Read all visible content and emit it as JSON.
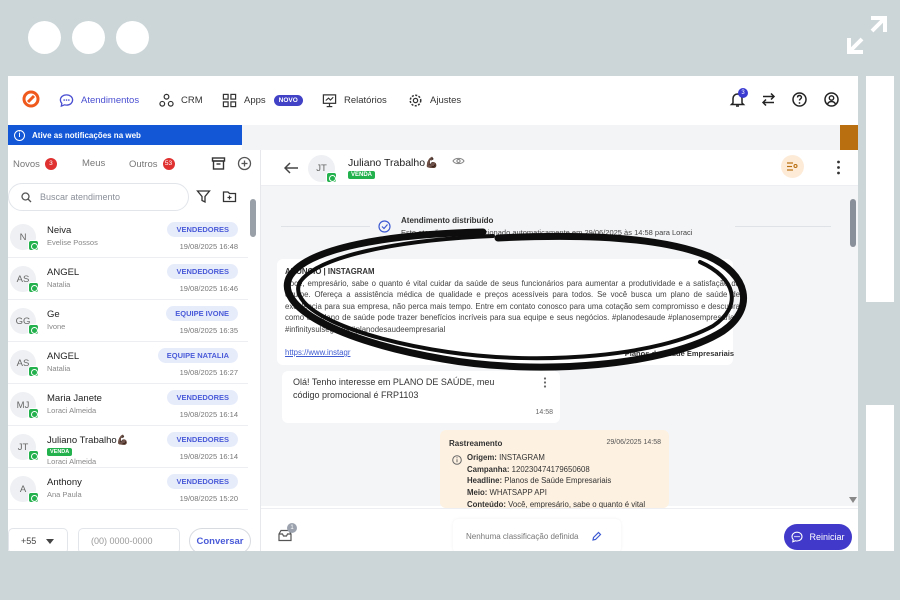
{
  "nav": {
    "items": [
      {
        "label": "Atendimentos",
        "icon": "chat-icon"
      },
      {
        "label": "CRM",
        "icon": "crm-icon"
      },
      {
        "label": "Apps",
        "icon": "apps-grid-icon",
        "badge": "NOVO"
      },
      {
        "label": "Relatórios",
        "icon": "chart-icon"
      },
      {
        "label": "Ajustes",
        "icon": "gear-icon"
      }
    ],
    "notification_count": "3"
  },
  "notif_bar": {
    "text": "Ative as notificações na web"
  },
  "tabs": [
    {
      "label": "Novos",
      "count": "3"
    },
    {
      "label": "Meus"
    },
    {
      "label": "Outros",
      "count": "53"
    }
  ],
  "search": {
    "placeholder": "Buscar atendimento"
  },
  "conversations": [
    {
      "initials": "N",
      "name": "Neiva",
      "sub": "Evelise Possos",
      "tag": "VENDEDORES",
      "time": "19/08/2025 16:48"
    },
    {
      "initials": "AS",
      "name": "ANGEL",
      "sub": "Natalia",
      "tag": "VENDEDORES",
      "time": "19/08/2025 16:46"
    },
    {
      "initials": "GG",
      "name": "Ge",
      "sub": "Ivone",
      "tag": "EQUIPE IVONE",
      "time": "19/08/2025 16:35"
    },
    {
      "initials": "AS",
      "name": "ANGEL",
      "sub": "Natalia",
      "tag": "EQUIPE NATALIA",
      "time": "19/08/2025 16:27"
    },
    {
      "initials": "MJ",
      "name": "Maria Janete",
      "sub": "Loraci Almeida",
      "tag": "VENDEDORES",
      "time": "19/08/2025 16:14"
    },
    {
      "initials": "JT",
      "name": "Juliano Trabalho💪🏿",
      "label": "VENDA",
      "sub": "Loraci Almeida",
      "tag": "VENDEDORES",
      "time": "19/08/2025 16:14"
    },
    {
      "initials": "A",
      "name": "Anthony",
      "sub": "Ana Paula",
      "tag": "VENDEDORES",
      "time": "19/08/2025 15:20"
    }
  ],
  "phone_input": {
    "country_code": "+55",
    "placeholder": "(00) 0000-0000",
    "button": "Conversar"
  },
  "chat": {
    "contact_initials": "JT",
    "contact_name": "Juliano Trabalho💪🏿",
    "contact_label": "VENDA",
    "event_title": "Atendimento distribuído",
    "event_text": "Este atendimento foi direcionado automaticamente em 29/06/2025 às 14:58 para Loraci",
    "ad_title": "ANÚNCIO | INSTAGRAM",
    "ad_body": "Você, empresário, sabe o quanto é vital cuidar da saúde de seus funcionários para aumentar a produtividade e a satisfação da equipe. Ofereça a assistência médica de qualidade e preços acessíveis para todos. Se você busca um plano de saúde de excelência para sua empresa, não perca mais tempo. Entre em contato conosco para uma cotação sem compromisso e descubra como um plano de saúde pode trazer benefícios incríveis para sua equipe e seus negócios. #planodesaude #planosempresariais #infinitysulseguros #planodesaudeempresarial",
    "ad_link": "https://www.instagr",
    "ad_caption": "Planos de Saúde Empresariais",
    "message_text": "Olá! Tenho interesse em PLANO DE SAÚDE, meu código promocional é FRP1103",
    "message_time": "14:58",
    "tracking": {
      "title": "Rastreamento",
      "time": "29/06/2025 14:58",
      "rows": [
        {
          "key": "Origem:",
          "value": "INSTAGRAM"
        },
        {
          "key": "Campanha:",
          "value": "120230474179650608"
        },
        {
          "key": "Headline:",
          "value": "Planos de Saúde Empresariais"
        },
        {
          "key": "Meio:",
          "value": "WHATSAPP API"
        },
        {
          "key": "Conteúdo:",
          "value": "Você, empresário, sabe o quanto é vital"
        }
      ]
    },
    "footer_badge": "1",
    "classification": "Nenhuma classificação definida",
    "restart_button": "Reiniciar"
  }
}
